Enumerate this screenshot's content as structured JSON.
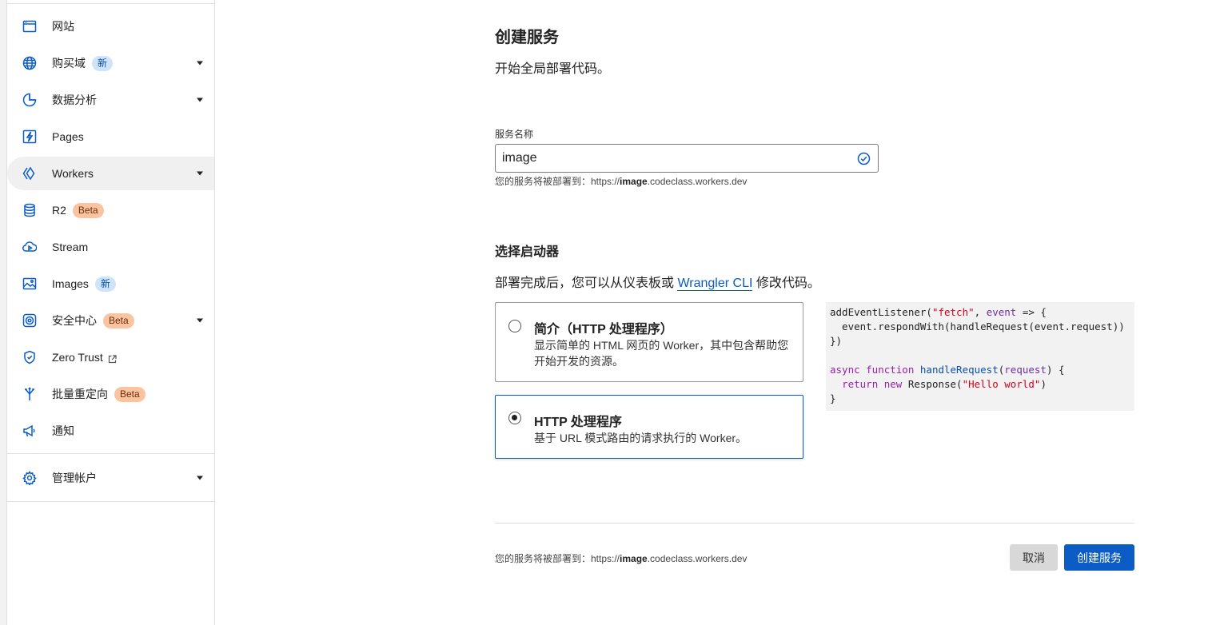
{
  "sidebar": {
    "items": [
      {
        "label": "网站",
        "icon": "browser-window-icon"
      },
      {
        "label": "购买域",
        "icon": "globe-icon",
        "badge": "新"
      },
      {
        "label": "数据分析",
        "icon": "pie-chart-icon"
      },
      {
        "label": "Pages",
        "icon": "lightning-icon"
      },
      {
        "label": "Workers",
        "icon": "workers-diamond-icon"
      },
      {
        "label": "R2",
        "icon": "database-icon",
        "badge": "Beta"
      },
      {
        "label": "Stream",
        "icon": "cloud-play-icon"
      },
      {
        "label": "Images",
        "icon": "image-icon",
        "badge": "新"
      },
      {
        "label": "安全中心",
        "icon": "shield-target-icon",
        "badge": "Beta"
      },
      {
        "label": "Zero Trust",
        "icon": "shield-check-icon"
      },
      {
        "label": "批量重定向",
        "icon": "fork-arrow-icon",
        "badge": "Beta"
      },
      {
        "label": "通知",
        "icon": "megaphone-icon"
      },
      {
        "label": "管理帐户",
        "icon": "gear-icon"
      }
    ]
  },
  "main": {
    "title": "创建服务",
    "subtitle": "开始全局部署代码。",
    "service_name": {
      "label": "服务名称",
      "value": "image",
      "hint_prefix": "您的服务将被部署到：https://",
      "hint_bold": "image",
      "hint_suffix": ".codeclass.workers.dev"
    },
    "starter": {
      "title": "选择启动器",
      "desc_before": "部署完成后，您可以从仪表板或 ",
      "desc_link": "Wrangler CLI",
      "desc_after": " 修改代码。",
      "options": [
        {
          "title": "简介（HTTP 处理程序）",
          "desc": "显示简单的 HTML 网页的 Worker，其中包含帮助您开始开发的资源。",
          "selected": false
        },
        {
          "title": "HTTP 处理程序",
          "desc": "基于 URL 模式路由的请求执行的 Worker。",
          "selected": true
        }
      ]
    },
    "code": {
      "line1_a": "addEventListener(",
      "line1_str": "\"fetch\"",
      "line1_b": ", ",
      "line1_var": "event",
      "line1_c": " => {",
      "line2": "  event.respondWith(handleRequest(event.request))",
      "line3": "})",
      "line5_kw": "async function",
      "line5_fn": "handleRequest",
      "line5_a": "(",
      "line5_var": "request",
      "line5_b": ") {",
      "line6_kw": "return new",
      "line6_a": " Response(",
      "line6_str": "\"Hello world\"",
      "line6_b": ")",
      "line7": "}"
    },
    "footer": {
      "hint_prefix": "您的服务将被部署到：https://",
      "hint_bold": "image",
      "hint_suffix": ".codeclass.workers.dev",
      "cancel_label": "取消",
      "create_label": "创建服务"
    }
  },
  "colors": {
    "accent": "#0b5cc5",
    "badge_new_bg": "#cfe4fb",
    "badge_beta_bg": "#fbc4a0"
  }
}
